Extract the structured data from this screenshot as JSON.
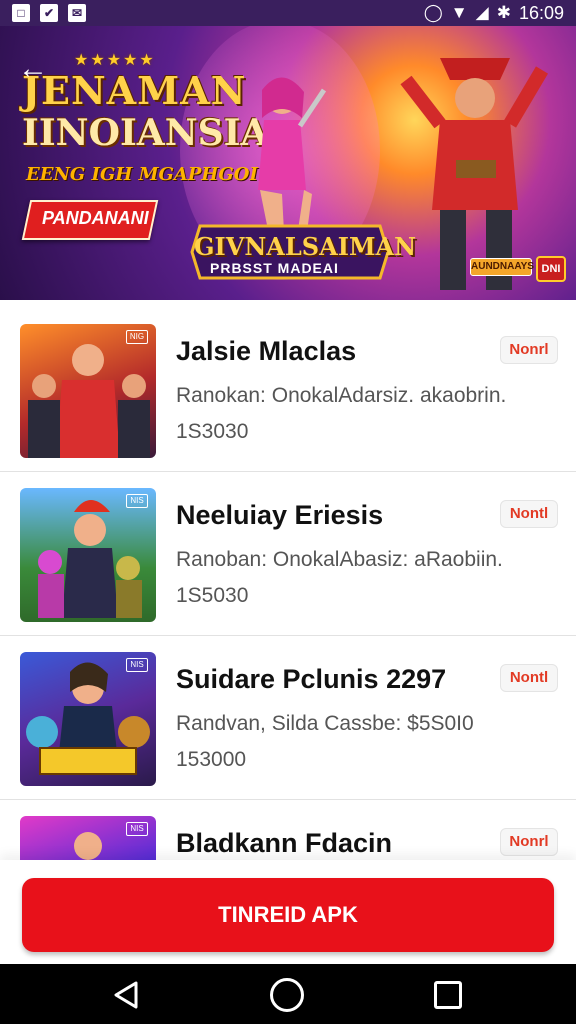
{
  "status_bar": {
    "time": "16:09",
    "left_icons": [
      "image-icon",
      "tag-icon",
      "mail-icon"
    ],
    "right_icons": [
      "alarm-icon",
      "wifi-icon",
      "signal-icon",
      "bluetooth-icon"
    ]
  },
  "banner": {
    "title_line1": "JENAMAN",
    "title_line2": "IINOIANSIA",
    "subtitle": "EENG IGH MGAPHGOI",
    "ribbon_label": "PANDANANI",
    "logo_title": "GIVNALSAIMAN",
    "logo_sub": "PRBSST MADEAI",
    "badge_small": "AUNDNAAYS",
    "badge_round": "DNI"
  },
  "list": {
    "items": [
      {
        "title": "Jalsie Mlaclas",
        "desc": "Ranokan: OnokalAdarsiz. akaobrin.",
        "num": "1S3030",
        "btn": "Nonrl"
      },
      {
        "title": "Neeluiay Eriesis",
        "desc": "Ranoban: OnokalAbasiz: aRaobiin.",
        "num": "1S5030",
        "btn": "Nontl"
      },
      {
        "title": "Suidare Pclunis 2297",
        "desc": "Randvan, Silda Cassbe: $5S0I0",
        "num": "153000",
        "btn": "Nontl"
      },
      {
        "title": "Bladkann Fdacin",
        "desc": "",
        "num": "",
        "btn": "Nonrl"
      }
    ],
    "thumb_tags": [
      "NIG",
      "NIS",
      "NIS",
      "NIS"
    ]
  },
  "action": {
    "label": "TINREID APK"
  },
  "colors": {
    "accent": "#e8111a",
    "status_bg": "#3a1f5e"
  }
}
